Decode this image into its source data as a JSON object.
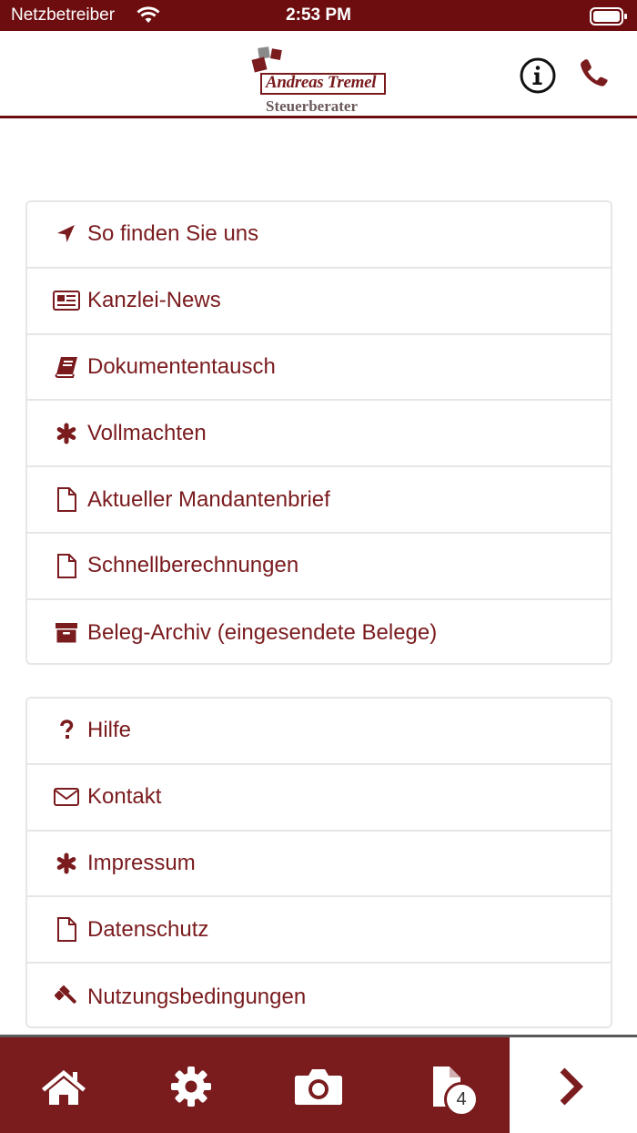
{
  "status_bar": {
    "carrier": "Netzbetreiber",
    "time": "2:53 PM"
  },
  "header": {
    "logo_name": "Andreas Tremel",
    "logo_subtitle": "Steuerberater",
    "info_icon": "info-circle-icon",
    "phone_icon": "phone-icon"
  },
  "menu_group_1": {
    "items": [
      {
        "label": "So finden Sie uns",
        "icon": "location-arrow-icon"
      },
      {
        "label": "Kanzlei-News",
        "icon": "newspaper-icon"
      },
      {
        "label": "Dokumententausch",
        "icon": "book-icon"
      },
      {
        "label": "Vollmachten",
        "icon": "asterisk-icon"
      },
      {
        "label": "Aktueller Mandantenbrief",
        "icon": "file-icon"
      },
      {
        "label": "Schnellberechnungen",
        "icon": "file-icon"
      },
      {
        "label": "Beleg-Archiv (eingesendete Belege)",
        "icon": "archive-icon"
      }
    ]
  },
  "menu_group_2": {
    "items": [
      {
        "label": "Hilfe",
        "icon": "question-icon"
      },
      {
        "label": "Kontakt",
        "icon": "envelope-icon"
      },
      {
        "label": "Impressum",
        "icon": "asterisk-icon"
      },
      {
        "label": "Datenschutz",
        "icon": "file-icon"
      },
      {
        "label": "Nutzungsbedingungen",
        "icon": "gavel-icon"
      }
    ]
  },
  "tab_bar": {
    "tabs": [
      "home-icon",
      "gear-icon",
      "camera-icon",
      "document-icon",
      "chevron-right-icon"
    ],
    "documents_badge": "4"
  },
  "colors": {
    "brand": "#7a1b1e",
    "status_bar": "#6e0d10",
    "divider": "#e6e6e6"
  }
}
